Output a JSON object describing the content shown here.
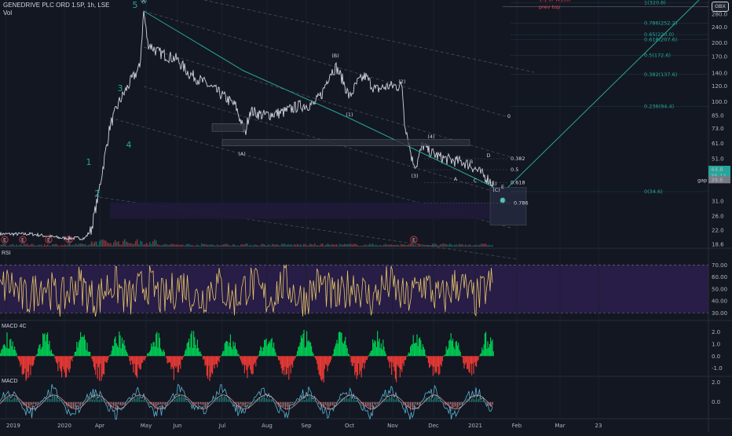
{
  "header": {
    "symbol_line": "GENEDRIVE PLC ORD 1.5P, 1h, LSE",
    "vol_label": "Vol",
    "currency_badge": "GBX"
  },
  "panes": {
    "rsi_title": "RSI",
    "macd4c_title": "MACD 4C",
    "macd_title": "MACD"
  },
  "chart_data": [
    {
      "type": "line",
      "pane": "price",
      "scale": "log",
      "x_tick_labels": [
        "2019",
        "2020",
        "Apr",
        "May",
        "Jun",
        "Jul",
        "Aug",
        "Sep",
        "Oct",
        "Nov",
        "Dec",
        "2021",
        "Feb",
        "Mar",
        "23"
      ],
      "y_tick_labels": [
        "280.0",
        "240.0",
        "200.0",
        "170.0",
        "140.0",
        "120.0",
        "100.0",
        "85.0",
        "73.0",
        "61.0",
        "51.0",
        "44.8",
        "39.6",
        "31.0",
        "26.0",
        "22.0",
        "18.6"
      ],
      "price_badges": [
        {
          "label": "44.8",
          "color": "#26a69a"
        },
        {
          "label": "35.11",
          "color": "#26a69a"
        },
        {
          "label": "39.6",
          "color": "#787b86"
        }
      ],
      "fib_labels": [
        {
          "text": "1(320.8)",
          "color": "#26a69a",
          "price": 320.8
        },
        {
          "text": "0.786(252.2)",
          "color": "#26a69a",
          "price": 252.2
        },
        {
          "text": "0.65(220.0)",
          "color": "#26a69a",
          "price": 220.0
        },
        {
          "text": "0.618(207.6)",
          "color": "#26a69a",
          "price": 207.6
        },
        {
          "text": "0.5(172.6)",
          "color": "#26a69a",
          "price": 172.6
        },
        {
          "text": "0.382(137.6)",
          "color": "#26a69a",
          "price": 137.6
        },
        {
          "text": "0.236(94.4)",
          "color": "#26a69a",
          "price": 94.4
        },
        {
          "text": "0(34.6)",
          "color": "#26a69a",
          "price": 34.6
        },
        {
          "text": "0.382",
          "color": "#d1d4dc",
          "price": 51.0
        },
        {
          "text": "0.5",
          "color": "#d1d4dc",
          "price": 44.8
        },
        {
          "text": "0.618",
          "color": "#d1d4dc",
          "price": 38.5
        },
        {
          "text": "0.786",
          "color": "#d1d4dc",
          "price": 30.2
        },
        {
          "text": "1:1 of W1(a)",
          "color": "#f23645",
          "price": 333
        },
        {
          "text": "prev top",
          "color": "#f23645",
          "price": 305
        },
        {
          "text": "gap",
          "color": "#d1d4dc",
          "price": 39.6
        }
      ],
      "wave_labels": [
        {
          "text": "1",
          "color": "#26a69a"
        },
        {
          "text": "2",
          "color": "#26a69a"
        },
        {
          "text": "3",
          "color": "#26a69a"
        },
        {
          "text": "4",
          "color": "#26a69a"
        },
        {
          "text": "5",
          "color": "#26a69a"
        },
        {
          "text": "A",
          "color": "#26a69a"
        },
        {
          "text": "B",
          "color": "#26a69a"
        },
        {
          "text": "(A)",
          "color": "#f23645"
        },
        {
          "text": "(B)",
          "color": "#f23645"
        },
        {
          "text": "(C)",
          "color": "#f23645"
        },
        {
          "text": "(1)",
          "color": "#d1d4dc"
        },
        {
          "text": "(2)",
          "color": "#d1d4dc"
        },
        {
          "text": "(3)",
          "color": "#d1d4dc"
        },
        {
          "text": "(4)",
          "color": "#d1d4dc"
        },
        {
          "text": "(5)",
          "color": "#d1d4dc"
        },
        {
          "text": "A",
          "color": "#787b86"
        },
        {
          "text": "B",
          "color": "#787b86"
        },
        {
          "text": "C",
          "color": "#787b86"
        },
        {
          "text": "D",
          "color": "#787b86"
        },
        {
          "text": "E",
          "color": "#787b86"
        },
        {
          "text": "0",
          "color": "#787b86"
        }
      ],
      "event_markers": [
        "E",
        "E",
        "E",
        "E",
        "E"
      ],
      "colors": {
        "price_line": "#d1d4dc",
        "impulse": "#26a69a",
        "channel": "#787b86",
        "highlight": "#f23645"
      }
    },
    {
      "type": "line",
      "pane": "RSI",
      "y_tick_labels": [
        "70.00",
        "60.00",
        "50.00",
        "40.00",
        "30.00"
      ],
      "ylim": [
        25,
        80
      ],
      "band": [
        30,
        70
      ],
      "colors": {
        "line": "#e7c36a",
        "band_fill": "#2a1e4a"
      }
    },
    {
      "type": "bar",
      "pane": "MACD 4C",
      "y_tick_labels": [
        "2.0",
        "1.0",
        "0.0",
        "-1.0"
      ],
      "ylim": [
        -1.6,
        2.8
      ],
      "colors": {
        "positive": "#00c853",
        "negative": "#e53935"
      }
    },
    {
      "type": "line",
      "pane": "MACD",
      "y_tick_labels": [
        "2.0",
        "0.0"
      ],
      "ylim": [
        -1.6,
        2.5
      ],
      "colors": {
        "macd": "#5ab4d4",
        "signal": "#ef9a9a"
      }
    }
  ]
}
